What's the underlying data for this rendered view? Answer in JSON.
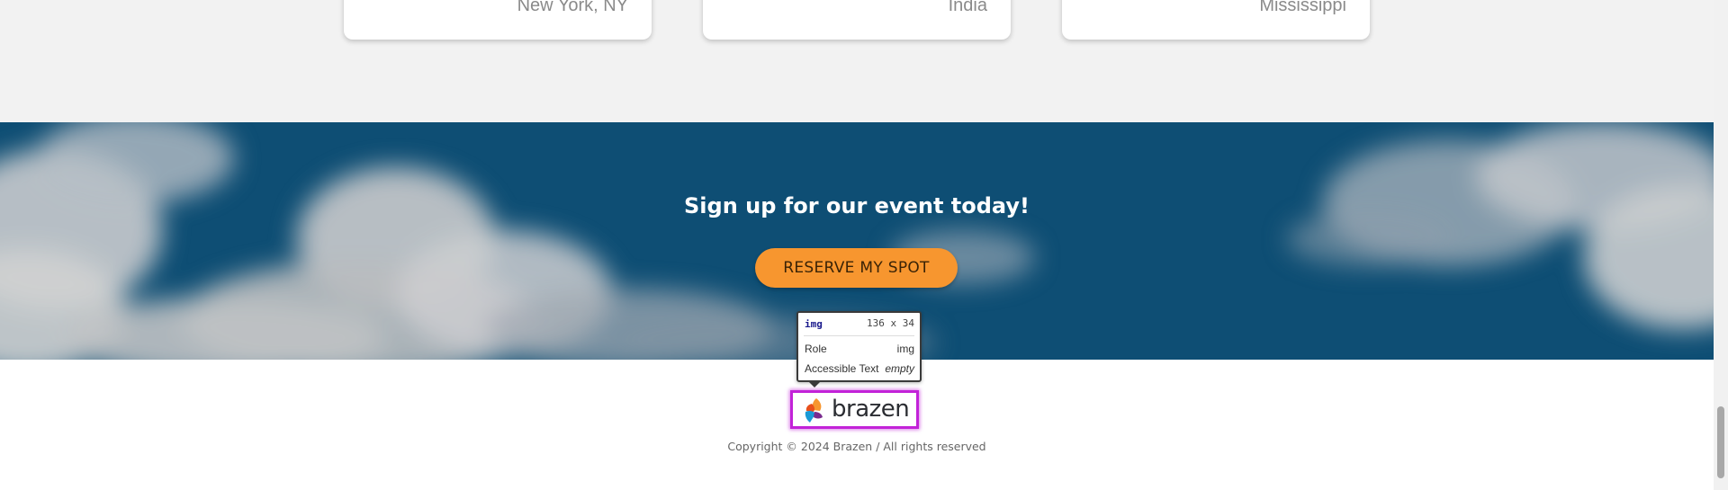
{
  "cards": [
    {
      "location": "New York, NY"
    },
    {
      "location": "India"
    },
    {
      "location": "Mississippi"
    }
  ],
  "cta": {
    "title": "Sign up for our event today!",
    "button_label": "RESERVE MY SPOT",
    "button_color": "#f7962f",
    "background_color": "#0e4e74"
  },
  "footer": {
    "brand_name": "brazen",
    "copyright": "Copyright © 2024 Brazen / All rights reserved"
  },
  "inspector_tooltip": {
    "tag": "img",
    "dimensions": "136 x 34",
    "role_label": "Role",
    "role_value": "img",
    "accessible_text_label": "Accessible Text",
    "accessible_text_value": "empty",
    "highlight_color": "#c222d8"
  }
}
